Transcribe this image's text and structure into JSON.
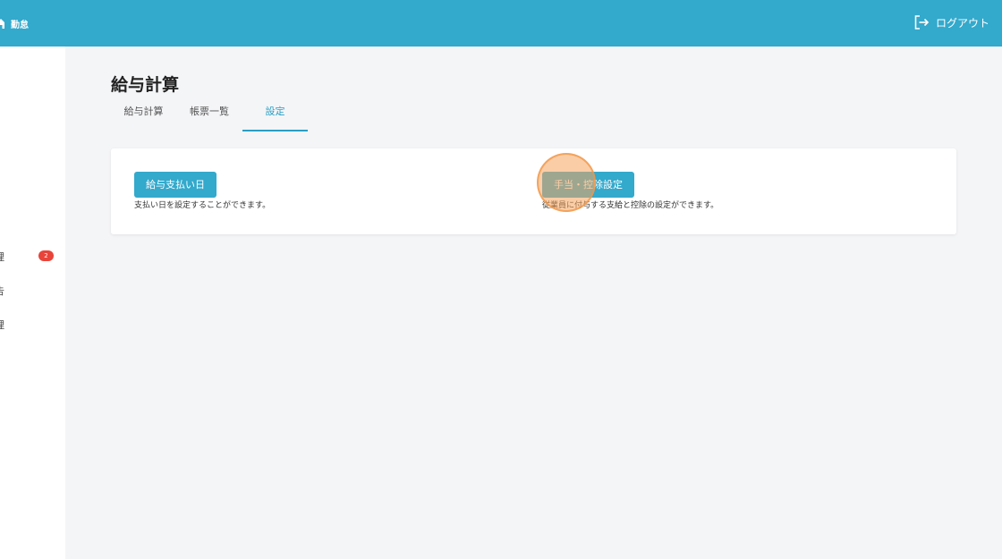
{
  "header": {
    "brand_label": "勤怠",
    "logout_label": "ログアウト"
  },
  "sidebar": {
    "items": [
      {
        "label": "理"
      },
      {
        "label": "告"
      },
      {
        "label": "理"
      }
    ],
    "badge_count": "2"
  },
  "main": {
    "title": "給与計算",
    "tabs": [
      {
        "label": "給与計算"
      },
      {
        "label": "帳票一覧"
      },
      {
        "label": "設定",
        "active": true
      }
    ]
  },
  "settings": [
    {
      "button_label": "給与支払い日",
      "description": "支払い日を設定することができます。"
    },
    {
      "button_label": "手当・控除設定",
      "description": "従業員に付与する支給と控除の設定ができます。"
    }
  ],
  "colors": {
    "accent": "#33a9cc",
    "badge": "#e8443a",
    "click_indicator": "#f6a45c"
  }
}
